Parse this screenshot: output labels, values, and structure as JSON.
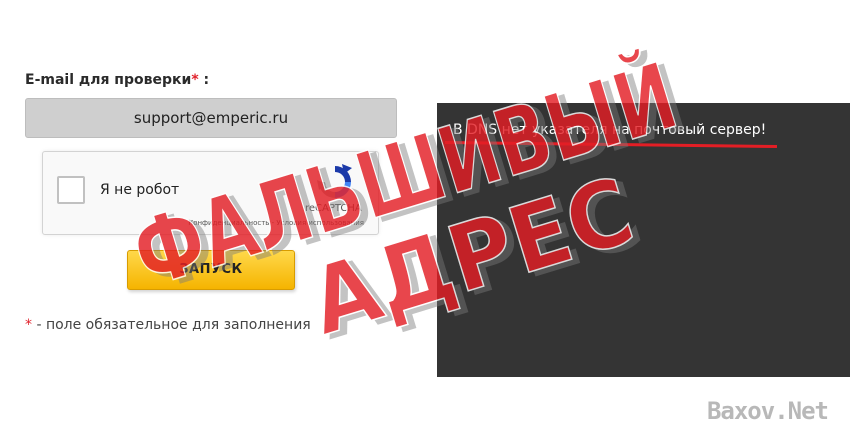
{
  "form": {
    "email_label": "E-mail для проверки",
    "required_mark": "*",
    "label_suffix": " :",
    "email_value": "support@emperic.ru",
    "captcha": {
      "checkbox_label": "Я не робот",
      "brand": "reCAPTCHA",
      "terms": "Конфиденциальность - Условия использования"
    },
    "launch_label": "ЗАПУСК",
    "required_note": " - поле обязательное для заполнения"
  },
  "result": {
    "message": "В DNS нет указателя на почтовый сервер!"
  },
  "stamp": {
    "line1": "ФАЛЬШИВЫЙ",
    "line2": "АДРЕС",
    "color": "#e31e25"
  },
  "watermark": "Baxov.Net"
}
